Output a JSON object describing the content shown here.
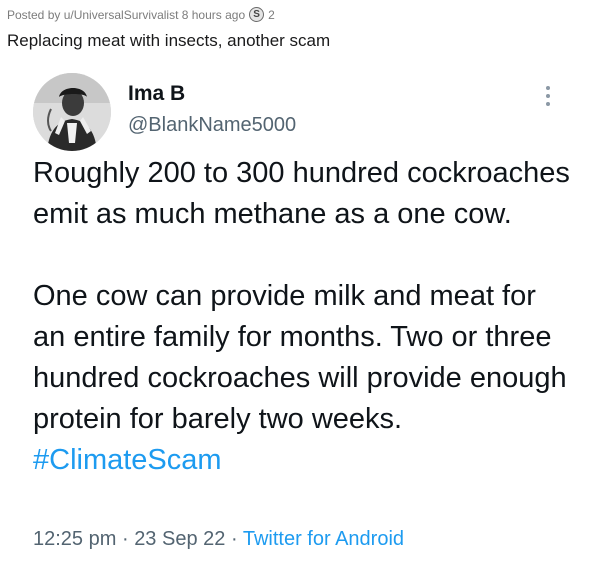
{
  "post": {
    "meta": "Posted by u/UniversalSurvivalist 8 hours ago",
    "award_count": "2",
    "title": "Replacing meat with insects, another scam"
  },
  "tweet": {
    "author_name": "Ima B",
    "author_handle": "@BlankName5000",
    "paragraph1": "Roughly 200 to 300 hundred cockroaches emit as much methane as a one cow.",
    "paragraph2": "One cow can provide milk and meat for an entire family for months. Two or three hundred cockroaches will provide enough protein for barely two weeks.",
    "hashtag": "#ClimateScam",
    "time": "12:25 pm",
    "date": "23 Sep 22",
    "source": "Twitter for Android",
    "separator": "·"
  },
  "colors": {
    "link_blue": "#1d9bf0",
    "secondary_text": "#536471",
    "primary_text": "#0f1419"
  }
}
